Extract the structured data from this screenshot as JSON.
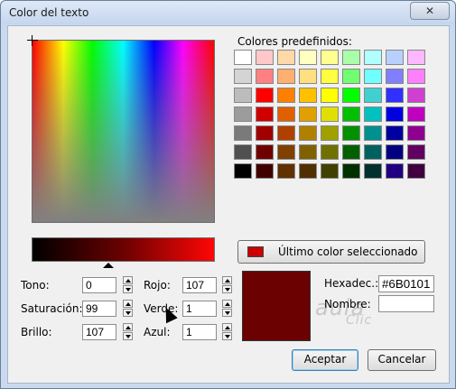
{
  "window": {
    "title": "Color del texto",
    "close_label": "✕"
  },
  "predef": {
    "label": "Colores predefinidos:",
    "colors": [
      "#ffffff",
      "#ffc8c8",
      "#ffd8a8",
      "#ffffc0",
      "#ffff90",
      "#a8ffa8",
      "#b0ffff",
      "#b8d0ff",
      "#ffb8ff",
      "#d4d4d4",
      "#ff8080",
      "#ffb070",
      "#ffe080",
      "#ffff40",
      "#70ff70",
      "#70ffff",
      "#8080ff",
      "#ff80ff",
      "#bcbcbc",
      "#ff0000",
      "#ff8000",
      "#ffc000",
      "#ffff00",
      "#00ff00",
      "#40d0d0",
      "#3030ff",
      "#d040d0",
      "#9c9c9c",
      "#d00000",
      "#e06000",
      "#e0a000",
      "#e0e000",
      "#00c000",
      "#00c0c0",
      "#0000e0",
      "#c000c0",
      "#7a7a7a",
      "#a00000",
      "#b04000",
      "#b08000",
      "#a0a000",
      "#009000",
      "#009090",
      "#0000a0",
      "#900090",
      "#505050",
      "#700000",
      "#804000",
      "#806000",
      "#707000",
      "#006000",
      "#006060",
      "#000080",
      "#600060",
      "#000000",
      "#400000",
      "#603000",
      "#503000",
      "#404000",
      "#003000",
      "#003030",
      "#200080",
      "#400040"
    ]
  },
  "last_button": {
    "label": "Último color seleccionado",
    "color": "#cc0000"
  },
  "fields": {
    "tono": {
      "label": "Tono:",
      "value": "0"
    },
    "saturacion": {
      "label": "Saturación:",
      "value": "99"
    },
    "brillo": {
      "label": "Brillo:",
      "value": "107"
    },
    "rojo": {
      "label": "Rojo:",
      "value": "107"
    },
    "verde": {
      "label": "Verde:",
      "value": "1"
    },
    "azul": {
      "label": "Azul:",
      "value": "1"
    },
    "hex": {
      "label": "Hexadec.:",
      "value": "#6B0101"
    },
    "nombre": {
      "label": "Nombre:",
      "value": ""
    }
  },
  "selected_color": "#6b0101",
  "buttons": {
    "accept": "Aceptar",
    "cancel": "Cancelar"
  },
  "watermark": {
    "line1": "aula",
    "line2": "Clic"
  }
}
